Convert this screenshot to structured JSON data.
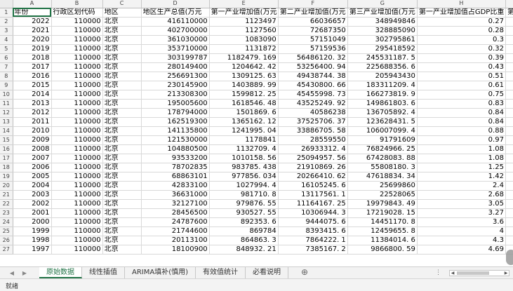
{
  "columns": [
    "A",
    "B",
    "C",
    "D",
    "E",
    "F",
    "G",
    "H"
  ],
  "header_cells": [
    "年份",
    "行政区划代码",
    "地区",
    "地区生产总值(万元",
    "第一产业增加值(万元",
    "第二产业增加值(万元",
    "第三产业增加值(万元",
    "第一产业增加值占GDP比重",
    "第"
  ],
  "rows": [
    [
      "2022",
      "110000",
      "北京",
      "416110000",
      "1123497",
      "66036657",
      "348949846",
      "0.27"
    ],
    [
      "2021",
      "110000",
      "北京",
      "402700000",
      "1127560",
      "72687350",
      "328885090",
      "0.28"
    ],
    [
      "2020",
      "110000",
      "北京",
      "361030000",
      "1083090",
      "57151049",
      "302795861",
      "0.3"
    ],
    [
      "2019",
      "110000",
      "北京",
      "353710000",
      "1131872",
      "57159536",
      "295418592",
      "0.32"
    ],
    [
      "2018",
      "110000",
      "北京",
      "303199787",
      "1182479. 169",
      "56486120. 32",
      "245531187. 5",
      "0.39"
    ],
    [
      "2017",
      "110000",
      "北京",
      "280149400",
      "1204642. 42",
      "53256400. 94",
      "225688356. 6",
      "0.43"
    ],
    [
      "2016",
      "110000",
      "北京",
      "256691300",
      "1309125. 63",
      "49438744. 38",
      "205943430",
      "0.51"
    ],
    [
      "2015",
      "110000",
      "北京",
      "230145900",
      "1403889. 99",
      "45430800. 66",
      "183311209. 4",
      "0.61"
    ],
    [
      "2014",
      "110000",
      "北京",
      "213308300",
      "1599812. 25",
      "45455998. 73",
      "166273819. 9",
      "0.75"
    ],
    [
      "2013",
      "110000",
      "北京",
      "195005600",
      "1618546. 48",
      "43525249. 92",
      "149861803. 6",
      "0.83"
    ],
    [
      "2012",
      "110000",
      "北京",
      "178794000",
      "1501869. 6",
      "40586238",
      "136705892. 4",
      "0.84"
    ],
    [
      "2011",
      "110000",
      "北京",
      "162519300",
      "1365162. 12",
      "37525706. 37",
      "123628431. 5",
      "0.84"
    ],
    [
      "2010",
      "110000",
      "北京",
      "141135800",
      "1241995. 04",
      "33886705. 58",
      "106007099. 4",
      "0.88"
    ],
    [
      "2009",
      "110000",
      "北京",
      "121530000",
      "1178841",
      "28559550",
      "91791609",
      "0.97"
    ],
    [
      "2008",
      "110000",
      "北京",
      "104880500",
      "1132709. 4",
      "26933312. 4",
      "76824966. 25",
      "1.08"
    ],
    [
      "2007",
      "110000",
      "北京",
      "93533200",
      "1010158. 56",
      "25094957. 56",
      "67428083. 88",
      "1.08"
    ],
    [
      "2006",
      "110000",
      "北京",
      "78702835",
      "983785. 438",
      "21910869. 26",
      "55808180. 3",
      "1.25"
    ],
    [
      "2005",
      "110000",
      "北京",
      "68863101",
      "977856. 034",
      "20266410. 62",
      "47618834. 34",
      "1.42"
    ],
    [
      "2004",
      "110000",
      "北京",
      "42833100",
      "1027994. 4",
      "16105245. 6",
      "25699860",
      "2.4"
    ],
    [
      "2003",
      "110000",
      "北京",
      "36631000",
      "981710. 8",
      "13117561. 1",
      "22528065",
      "2.68"
    ],
    [
      "2002",
      "110000",
      "北京",
      "32127100",
      "979876. 55",
      "11164167. 25",
      "19979843. 49",
      "3.05"
    ],
    [
      "2001",
      "110000",
      "北京",
      "28456500",
      "930527. 55",
      "10306944. 3",
      "17219028. 15",
      "3.27"
    ],
    [
      "2000",
      "110000",
      "北京",
      "24787600",
      "892353. 6",
      "9444075. 6",
      "14451170. 8",
      "3.6"
    ],
    [
      "1999",
      "110000",
      "北京",
      "21744600",
      "869784",
      "8393415. 6",
      "12459655. 8",
      "4"
    ],
    [
      "1998",
      "110000",
      "北京",
      "20113100",
      "864863. 3",
      "7864222. 1",
      "11384014. 6",
      "4.3"
    ],
    [
      "1997",
      "110000",
      "北京",
      "18100900",
      "848932. 21",
      "7385167. 2",
      "9866800. 59",
      "4.69"
    ]
  ],
  "sheet_tabs": [
    "原始数据",
    "线性插值",
    "ARIMA填补(慎用)",
    "有效值统计",
    "必看说明"
  ],
  "active_tab_index": 0,
  "nav": {
    "prev": "◀",
    "next": "▶",
    "add": "⊕",
    "more": "⋮",
    "left_arrow": "◀",
    "right_arrow": "▶"
  },
  "status": {
    "ready": "就绪"
  },
  "colors": {
    "accent": "#217346"
  }
}
